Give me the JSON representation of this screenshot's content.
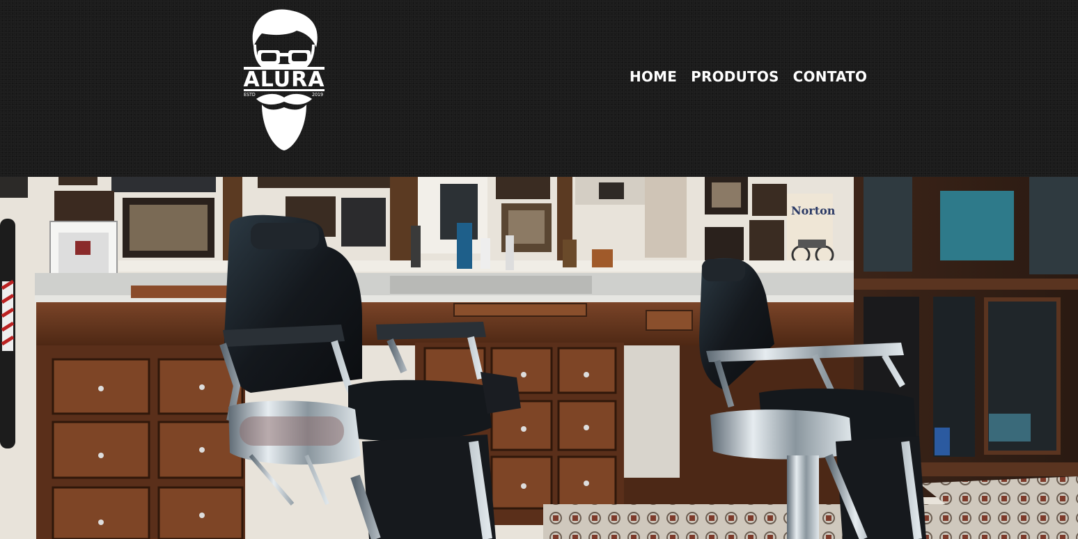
{
  "header": {
    "logo": {
      "brand": "ALURA",
      "est_label": "ESTD",
      "est_year": "2019"
    },
    "nav": [
      {
        "label": "HOME"
      },
      {
        "label": "PRODUTOS"
      },
      {
        "label": "CONTATO"
      }
    ]
  },
  "hero": {
    "image": "barbershop-interior",
    "poster_text": "Norton"
  },
  "colors": {
    "header_bg": "#1b1b1b",
    "text": "#ffffff",
    "wood": "#6b3b22",
    "leather": "#1a1d22"
  }
}
